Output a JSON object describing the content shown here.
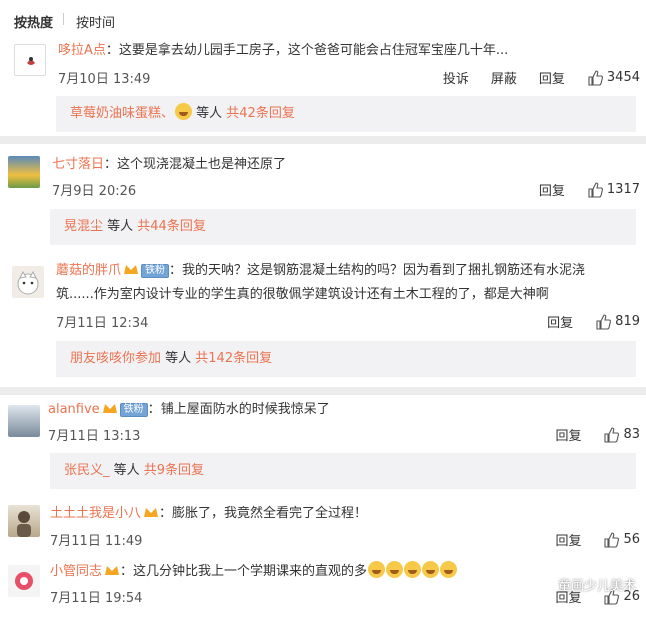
{
  "sort": {
    "hot": "按热度",
    "time": "按时间"
  },
  "comments": [
    {
      "user": "哆拉A点",
      "text": "这要是拿去幼儿园手工房子，这个爸爸可能会占住冠军宝座几十年...",
      "time": "7月10日 13:49",
      "report": "投诉",
      "block": "屏蔽",
      "reply": "回复",
      "likes": "3454",
      "reply_name": "草莓奶油味蛋糕、",
      "reply_mid": " 等人 ",
      "reply_count": "共42条回复"
    },
    {
      "user": "七寸落日",
      "text": "这个现浇混凝土也是神还原了",
      "time": "7月9日 20:26",
      "reply": "回复",
      "likes": "1317",
      "reply_name": "晃混尘",
      "reply_mid": " 等人 ",
      "reply_count": "共44条回复"
    },
    {
      "user": "蘑菇的胖爪",
      "badge": "铁粉",
      "text1": "我的天呐？这是钢筋混凝土结构的吗？因为看到了捆扎钢筋还有水泥浇",
      "text2": "筑......作为室内设计专业的学生真的很敬佩学建筑设计还有土木工程的了，都是大神啊",
      "time": "7月11日 12:34",
      "reply": "回复",
      "likes": "819",
      "reply_name": "朋友咳咳你参加",
      "reply_mid": " 等人 ",
      "reply_count": "共142条回复"
    },
    {
      "user": "alanfive",
      "badge": "铁粉",
      "text": "铺上屋面防水的时候我惊呆了",
      "time": "7月11日 13:13",
      "reply": "回复",
      "likes": "83",
      "reply_name": "张民义_",
      "reply_mid": " 等人 ",
      "reply_count": "共9条回复"
    },
    {
      "user": "土土土我是小八",
      "text": "膨胀了，我竟然全看完了全过程！",
      "time": "7月11日 11:49",
      "reply": "回复",
      "likes": "56"
    },
    {
      "user": "小管同志",
      "text": "这几分钟比我上一个学期课来的直观的多",
      "time": "7月11日 19:54",
      "reply": "回复",
      "likes": "26"
    }
  ],
  "watermark": "童画少儿美术",
  "colors": {
    "username": "#eb7350",
    "reply_bg": "#f2f2f5",
    "page_bg": "#ececec"
  }
}
